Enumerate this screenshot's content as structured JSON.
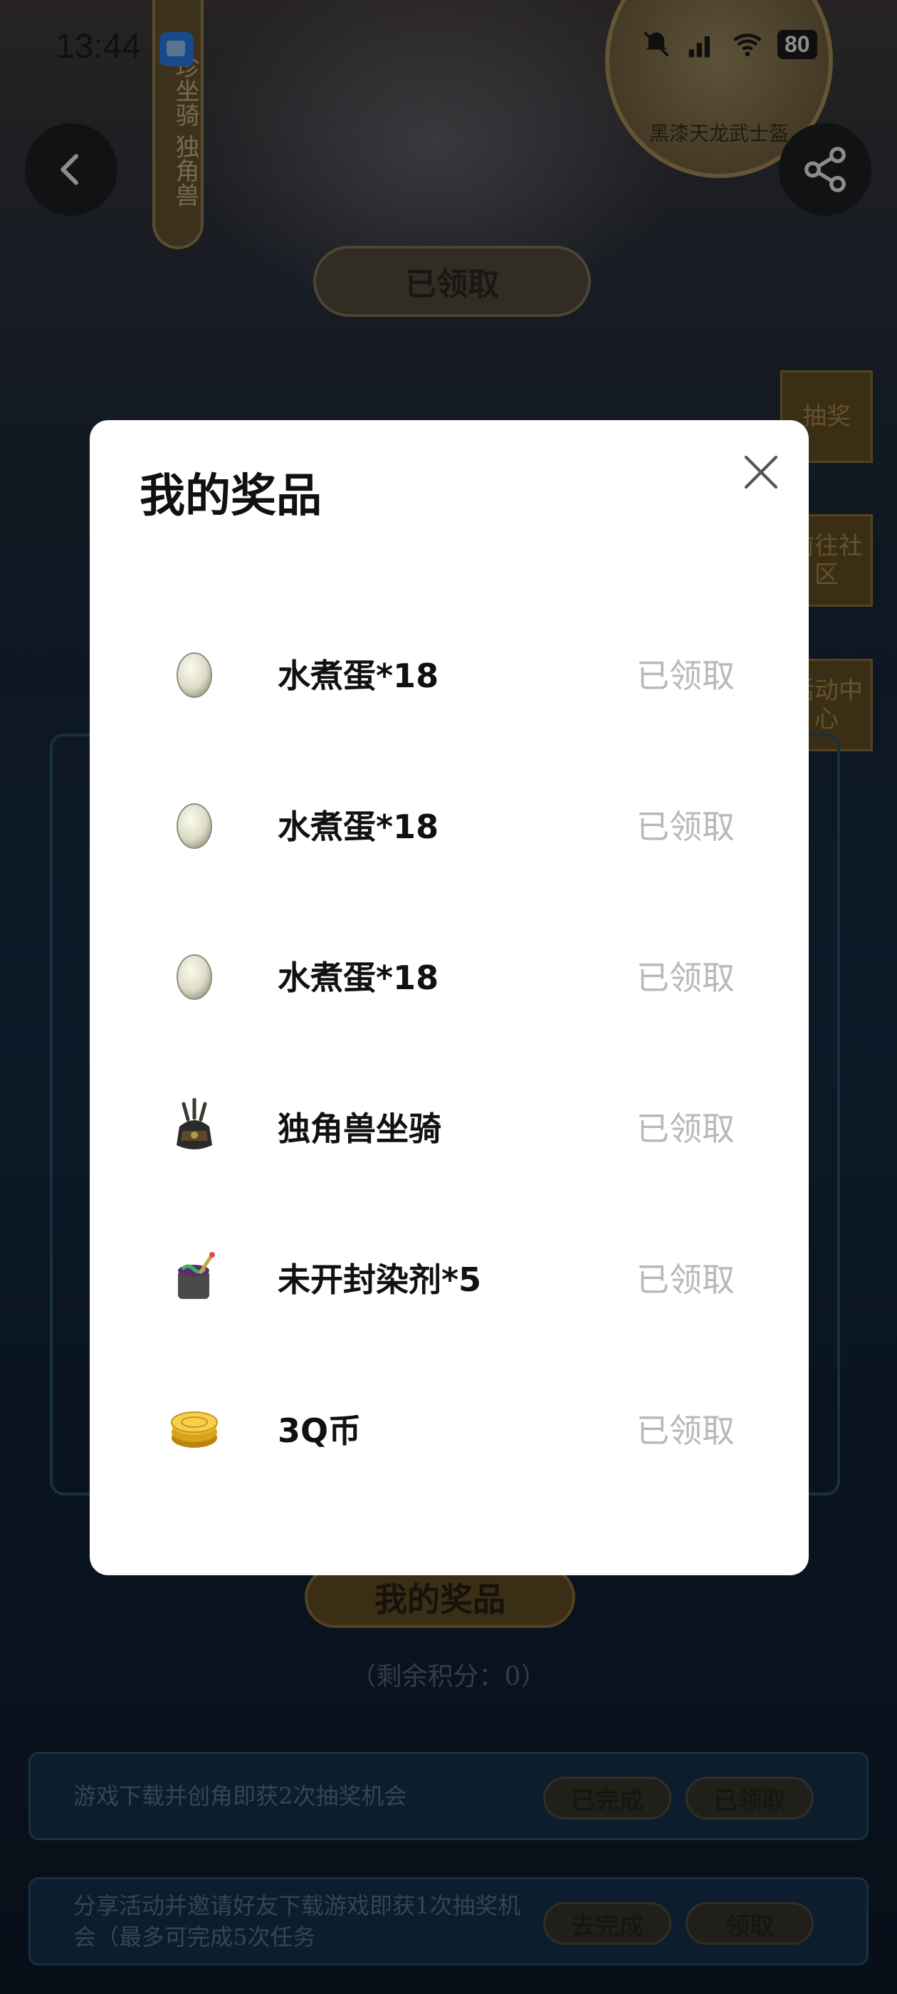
{
  "status_bar": {
    "time": "13:44",
    "battery": "80"
  },
  "background": {
    "banner_text": "珍坐骑 独角兽",
    "medal_label": "黑漆天龙武士盔",
    "claimed_label": "已领取",
    "side_buttons": [
      "抽奖",
      "前往社区",
      "活动中心"
    ],
    "my_prizes_label": "我的奖品",
    "remaining_points": "（剩余积分：0）",
    "tasks": [
      {
        "text": "游戏下载并创角即获2次抽奖机会",
        "button_1": "已完成",
        "button_2": "已领取"
      },
      {
        "text": "分享活动并邀请好友下载游戏即获1次抽奖机会（最多可完成5次任务",
        "button_1": "去完成",
        "button_2": "领取"
      }
    ]
  },
  "modal": {
    "title": "我的奖品",
    "items": [
      {
        "name": "水煮蛋*18",
        "status": "已领取",
        "icon": "egg-icon"
      },
      {
        "name": "水煮蛋*18",
        "status": "已领取",
        "icon": "egg-icon"
      },
      {
        "name": "水煮蛋*18",
        "status": "已领取",
        "icon": "egg-icon"
      },
      {
        "name": "独角兽坐骑",
        "status": "已领取",
        "icon": "unicorn-mount-icon"
      },
      {
        "name": "未开封染剂*5",
        "status": "已领取",
        "icon": "dye-bucket-icon"
      },
      {
        "name": "3Q币",
        "status": "已领取",
        "icon": "coin-stack-icon"
      }
    ]
  },
  "colors": {
    "overlay": "#000000",
    "modal_bg": "#ffffff",
    "status_grey": "#b8b8b8",
    "gold": "#9a7a3c"
  }
}
